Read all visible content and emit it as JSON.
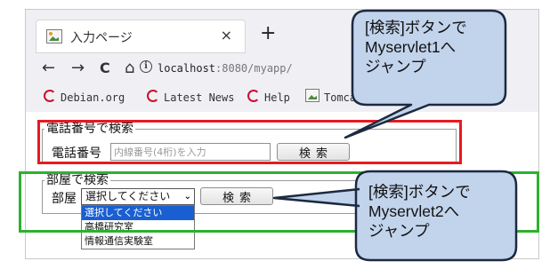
{
  "browser": {
    "tab_title": "入力ページ",
    "tab_close": "×",
    "new_tab": "+",
    "nav": {
      "back": "←",
      "forward": "→",
      "reload": "C",
      "home": "⌂"
    },
    "url_host": "localhost",
    "url_rest": ":8080/myapp/",
    "bookmarks": [
      "Debian.org",
      "Latest News",
      "Help",
      "Tomcat"
    ]
  },
  "phone_section": {
    "legend": "電話番号で検索",
    "label": "電話番号",
    "input_placeholder": "内線番号(4桁)を入力",
    "button": "検索"
  },
  "room_section": {
    "legend": "部屋で検索",
    "label": "部屋",
    "select_value": "選択してください",
    "options": [
      "選択してください",
      "高橋研究室",
      "情報通信実験室"
    ],
    "button": "検索"
  },
  "callouts": {
    "top": {
      "line1": "[検索]ボタンで",
      "line2": "Myservlet1へ",
      "line3": "ジャンプ"
    },
    "bottom": {
      "line1": "[検索]ボタンで",
      "line2": "Myservlet2へ",
      "line3": "ジャンプ"
    }
  },
  "colors": {
    "highlight_red": "#e8191f",
    "highlight_green": "#2eb12e",
    "callout_fill": "#c2d3ec",
    "select_highlight": "#1a5fd1"
  }
}
